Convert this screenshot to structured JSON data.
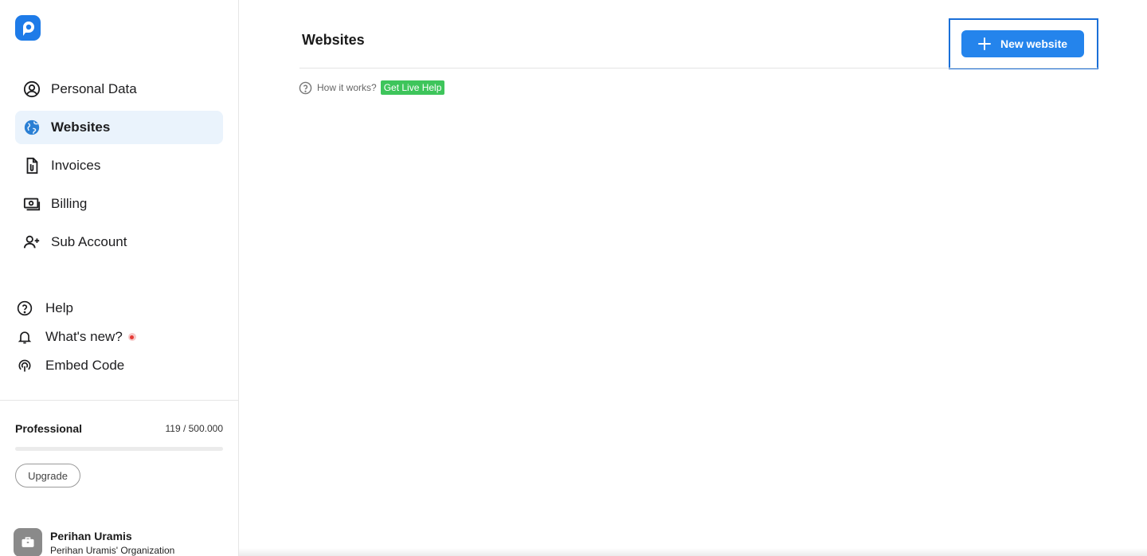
{
  "sidebar": {
    "nav": [
      {
        "label": "Personal Data",
        "icon": "user-circle-icon"
      },
      {
        "label": "Websites",
        "icon": "globe-icon",
        "active": true
      },
      {
        "label": "Invoices",
        "icon": "invoice-icon"
      },
      {
        "label": "Billing",
        "icon": "billing-icon"
      },
      {
        "label": "Sub Account",
        "icon": "add-user-icon"
      }
    ],
    "secondary": [
      {
        "label": "Help",
        "icon": "question-circle-icon"
      },
      {
        "label": "What's new?",
        "icon": "bell-icon"
      },
      {
        "label": "Embed Code",
        "icon": "broadcast-icon"
      }
    ],
    "plan": {
      "name": "Professional",
      "usage": "119 / 500.000",
      "usage_fraction": 0.000238,
      "upgrade_label": "Upgrade"
    },
    "user": {
      "name": "Perihan Uramis",
      "organization": "Perihan Uramis' Organization"
    }
  },
  "main": {
    "title": "Websites",
    "new_button_label": "New website",
    "how_it_works": "How it works?",
    "live_help_label": "Get Live Help"
  },
  "colors": {
    "accent": "#2484ec",
    "active_bg": "#eaf3fc",
    "live_help": "#3ec55b",
    "highlight_border": "#1a6fd8"
  }
}
